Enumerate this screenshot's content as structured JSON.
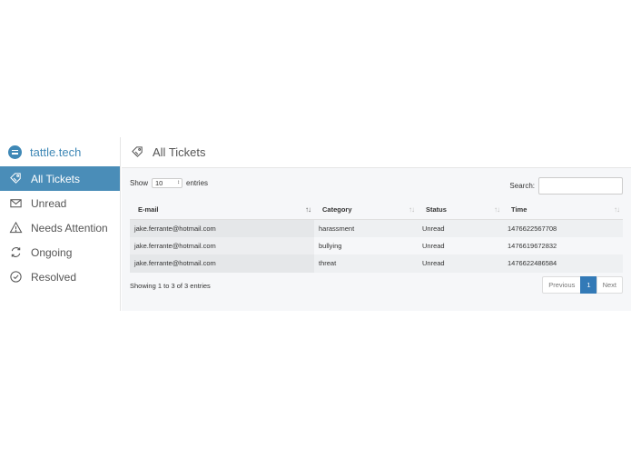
{
  "brand": {
    "name": "tattle.tech",
    "color": "#3f88b6"
  },
  "sidebar": {
    "items": [
      {
        "label": "All Tickets",
        "icon": "tag-icon",
        "active": true
      },
      {
        "label": "Unread",
        "icon": "envelope-icon",
        "active": false
      },
      {
        "label": "Needs Attention",
        "icon": "warning-icon",
        "active": false
      },
      {
        "label": "Ongoing",
        "icon": "refresh-icon",
        "active": false
      },
      {
        "label": "Resolved",
        "icon": "check-circle-icon",
        "active": false
      }
    ]
  },
  "header": {
    "title": "All Tickets",
    "icon": "tag-icon"
  },
  "table_controls": {
    "show_label": "Show",
    "entries_value": "10",
    "entries_label": "entries",
    "search_label": "Search:",
    "search_value": ""
  },
  "table": {
    "columns": [
      "E-mail",
      "Category",
      "Status",
      "Time"
    ],
    "rows": [
      [
        "jake.ferrante@hotmail.com",
        "harassment",
        "Unread",
        "1476622567708"
      ],
      [
        "jake.ferrante@hotmail.com",
        "bullying",
        "Unread",
        "1476619672832"
      ],
      [
        "jake.ferrante@hotmail.com",
        "threat",
        "Unread",
        "1476622486584"
      ]
    ]
  },
  "footer": {
    "info": "Showing 1 to 3 of 3 entries",
    "previous": "Previous",
    "current_page": "1",
    "next": "Next"
  },
  "colors": {
    "accent": "#4a8db8",
    "pager_active": "#337ab7"
  }
}
